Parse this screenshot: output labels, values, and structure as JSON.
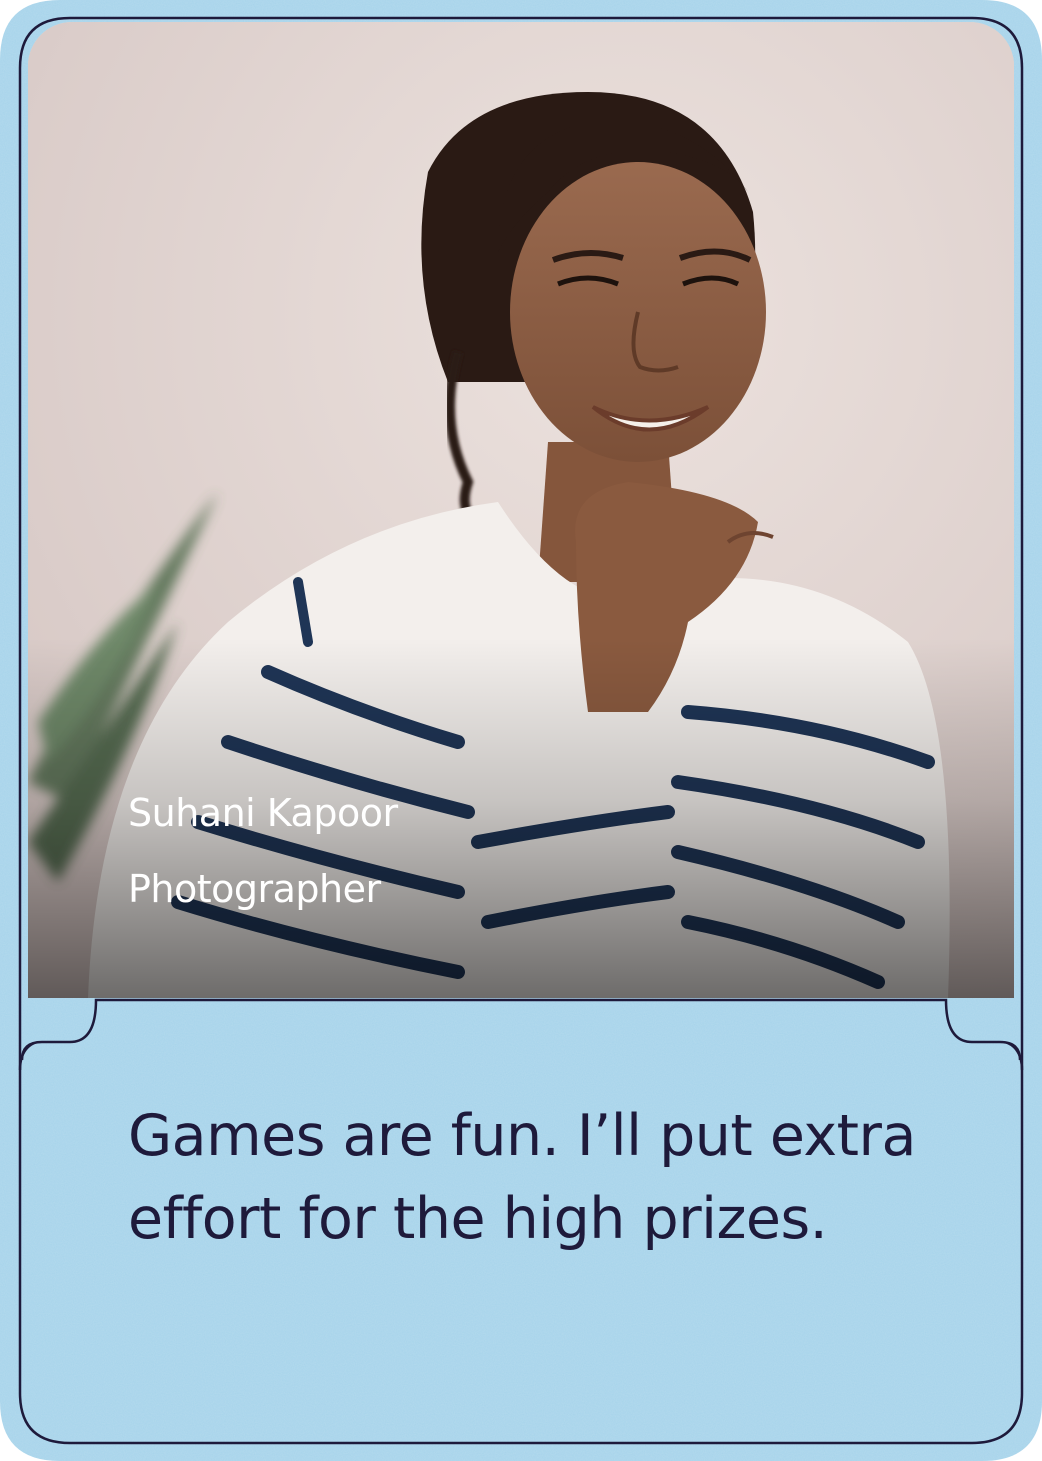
{
  "card": {
    "person_name": "Suhani Kapoor",
    "person_role": "Photographer",
    "quote": "Games are fun. I’ll put extra effort for the high prizes."
  },
  "colors": {
    "card_fill": "#a6d3ea",
    "card_outline": "#1e1a3b",
    "text_dark": "#1e1a3b",
    "text_light": "#ffffff"
  }
}
